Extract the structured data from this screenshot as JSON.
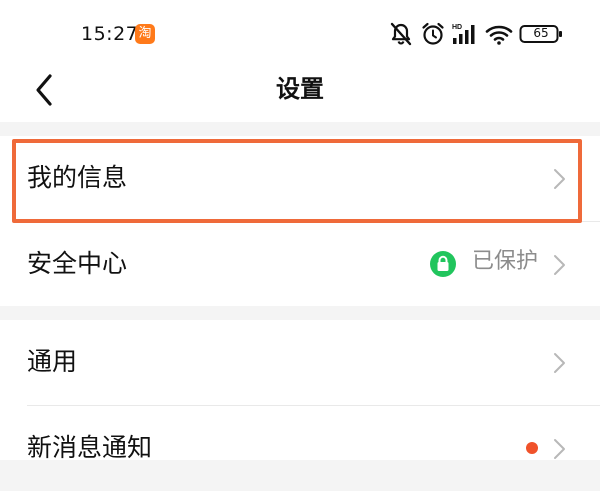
{
  "status_bar": {
    "time": "15:27",
    "app_badge": "淘",
    "battery_level": "65",
    "icons": [
      "mute-icon",
      "alarm-icon",
      "hd-signal-icon",
      "wifi-icon",
      "battery-icon"
    ]
  },
  "header": {
    "title": "设置",
    "back_icon": "chevron-left-icon"
  },
  "settings": {
    "group1": [
      {
        "label": "我的信息"
      },
      {
        "label": "安全中心",
        "status": "已保护",
        "status_icon": "lock-icon"
      }
    ],
    "group2": [
      {
        "label": "通用"
      },
      {
        "label": "新消息通知",
        "has_dot": true
      }
    ]
  },
  "colors": {
    "highlight": "#ef6a3a",
    "secure_green": "#21c55d",
    "notification_dot": "#f0522a",
    "badge_orange": "#ff7a1a",
    "chevron": "#b8b8b8",
    "status_text": "#8c8c8c"
  }
}
